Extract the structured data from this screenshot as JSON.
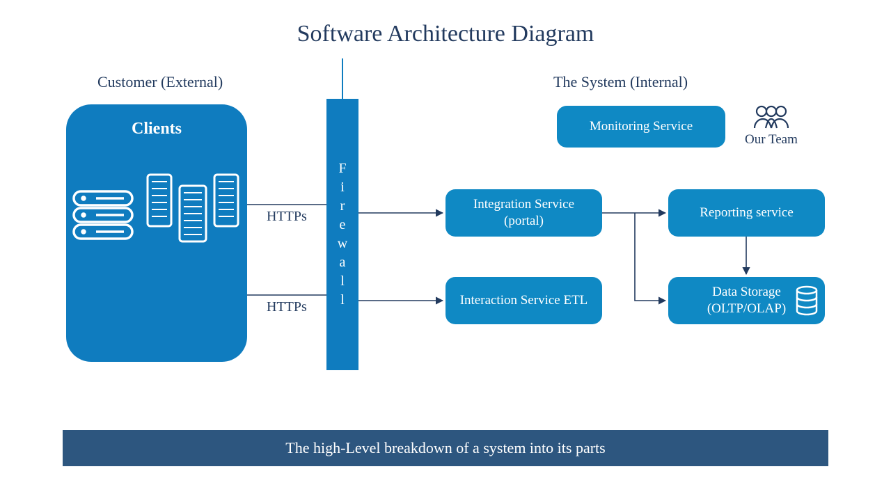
{
  "title": "Software Architecture Diagram",
  "section_left": "Customer (External)",
  "section_right": "The System (Internal)",
  "clients": {
    "title": "Clients"
  },
  "firewall": {
    "label": "Firewall"
  },
  "nodes": {
    "monitoring": "Monitoring Service",
    "integration": "Integration Service (portal)",
    "interaction": "Interaction Service ETL",
    "reporting": "Reporting service",
    "storage": "Data Storage (OLTP/OLAP)"
  },
  "team": "Our Team",
  "protocol1": "HTTPs",
  "protocol2": "HTTPs",
  "footer": "The high-Level breakdown of a system into its parts",
  "colors": {
    "blue": "#0f7cbf",
    "blue2": "#0f89c4",
    "navy": "#2d567f",
    "text": "#223a5e"
  }
}
